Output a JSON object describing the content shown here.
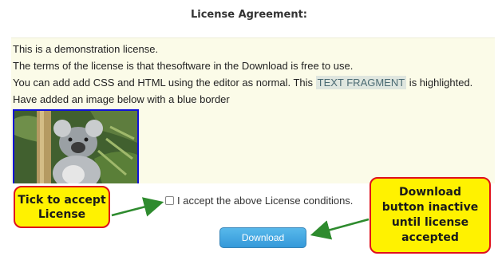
{
  "page": {
    "title": "License Agreement:"
  },
  "license": {
    "lines": [
      "This is a demonstration license.",
      "The terms of the license is that thesoftware in the Download is free to use."
    ],
    "line3_before": "You can add  add CSS and HTML using the editor as normal.  This ",
    "line3_highlight": "TEXT FRAGMENT",
    "line3_after": " is highlighted.",
    "line4": "Have added an image below with a blue border"
  },
  "accept": {
    "label": "I accept the above License conditions.",
    "checked": false
  },
  "download": {
    "label": "Download",
    "enabled": false
  },
  "annotations": {
    "left_callout": [
      "Tick to accept",
      "License"
    ],
    "right_callout": [
      "Download",
      "button inactive",
      "until license",
      "accepted"
    ]
  },
  "colors": {
    "callout_fill": "#fff200",
    "callout_border": "#e0101c",
    "arrow": "#2e8b2e",
    "image_border": "#1010d8",
    "button": "#2b94d8",
    "highlight": "#dfe6df"
  }
}
